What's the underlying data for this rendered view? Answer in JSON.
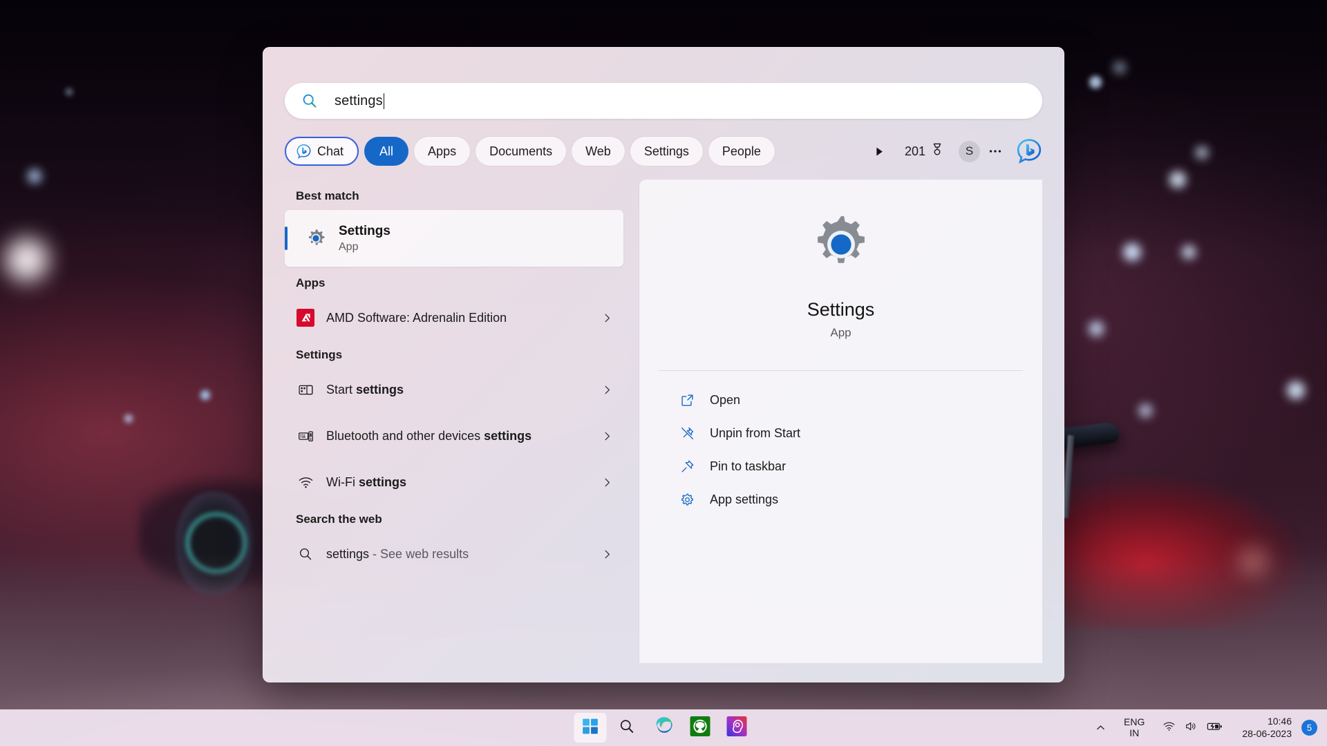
{
  "search": {
    "query": "settings",
    "icon": "search-icon"
  },
  "filters": {
    "chat": {
      "label": "Chat",
      "icon": "bing-chat-icon"
    },
    "tabs": [
      {
        "label": "All",
        "active": true
      },
      {
        "label": "Apps",
        "active": false
      },
      {
        "label": "Documents",
        "active": false
      },
      {
        "label": "Web",
        "active": false
      },
      {
        "label": "Settings",
        "active": false
      },
      {
        "label": "People",
        "active": false
      }
    ],
    "overflow_icon": "play-arrow-icon",
    "rewards": {
      "points": "201",
      "icon": "rewards-medal-icon"
    },
    "account": {
      "initial": "S",
      "icon": "user-avatar"
    },
    "more_icon": "ellipsis-icon",
    "bing_icon": "bing-logo-icon"
  },
  "results": {
    "best_match_header": "Best match",
    "best_match": {
      "title": "Settings",
      "subtitle": "App",
      "icon": "settings-gear-icon"
    },
    "apps_header": "Apps",
    "apps": [
      {
        "label": "AMD Software: Adrenalin Edition",
        "icon": "amd-icon",
        "chevron": "chevron-right-icon"
      }
    ],
    "settings_header": "Settings",
    "settings": [
      {
        "prefix": "Start ",
        "bold": "settings",
        "icon": "start-layout-icon",
        "chevron": "chevron-right-icon"
      },
      {
        "prefix": "Bluetooth and other devices ",
        "bold": "settings",
        "icon": "bluetooth-devices-icon",
        "chevron": "chevron-right-icon"
      },
      {
        "prefix": "Wi-Fi ",
        "bold": "settings",
        "icon": "wifi-icon",
        "chevron": "chevron-right-icon"
      }
    ],
    "web_header": "Search the web",
    "web": [
      {
        "prefix": "settings",
        "suffix": " - See web results",
        "icon": "search-glass-icon",
        "chevron": "chevron-right-icon"
      }
    ]
  },
  "preview": {
    "app_icon": "settings-gear-icon-large",
    "title": "Settings",
    "subtitle": "App",
    "actions": [
      {
        "label": "Open",
        "icon": "open-external-icon"
      },
      {
        "label": "Unpin from Start",
        "icon": "unpin-icon"
      },
      {
        "label": "Pin to taskbar",
        "icon": "pin-icon"
      },
      {
        "label": "App settings",
        "icon": "gear-icon"
      }
    ]
  },
  "taskbar": {
    "buttons": [
      {
        "name": "start-button",
        "icon": "windows-logo-icon",
        "active": true
      },
      {
        "name": "search-button",
        "icon": "search-icon",
        "active": false
      },
      {
        "name": "edge-button",
        "icon": "edge-icon",
        "active": false
      },
      {
        "name": "xbox-button",
        "icon": "xbox-icon",
        "active": false
      },
      {
        "name": "app-button",
        "icon": "gradient-app-icon",
        "active": false
      }
    ],
    "tray": {
      "chevron_icon": "chevron-up-icon",
      "language_line1": "ENG",
      "language_line2": "IN",
      "wifi_icon": "wifi-icon",
      "volume_icon": "speaker-icon",
      "battery_icon": "battery-charging-icon",
      "time": "10:46",
      "date": "28-06-2023",
      "notification_count": "5"
    }
  },
  "colors": {
    "accent_blue": "#1668c8",
    "chat_outline": "#3b5fe0",
    "amd_red": "#d8092e",
    "xbox_green": "#107c10",
    "panel_bg": "#f2e6ed"
  }
}
